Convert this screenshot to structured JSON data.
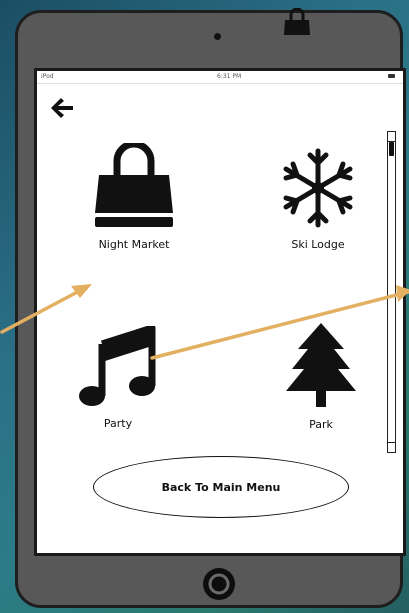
{
  "statusbar": {
    "device": "iPod",
    "time": "6:31 PM"
  },
  "tiles": [
    {
      "label": "Night Market",
      "icon": "shopping-bag-icon"
    },
    {
      "label": "Ski Lodge",
      "icon": "snowflake-icon"
    },
    {
      "label": "Party",
      "icon": "music-note-icon"
    },
    {
      "label": "Park",
      "icon": "tree-icon"
    }
  ],
  "main_menu_button": {
    "label": "Back To Main Menu"
  },
  "icons": {
    "back": "back-arrow-icon",
    "home": "home-button-icon",
    "badge": "shopping-bag-icon"
  },
  "colors": {
    "annotation_arrow": "#e3b062",
    "device_frame": "#585858",
    "screen": "#ffffff"
  }
}
